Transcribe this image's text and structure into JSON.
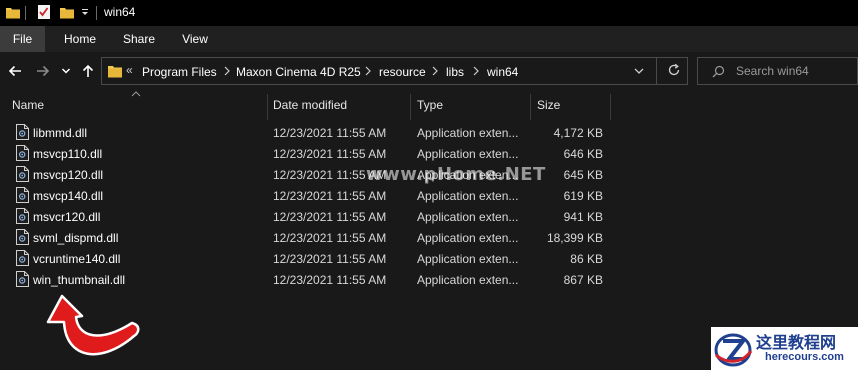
{
  "window": {
    "title": "win64"
  },
  "ribbon": {
    "tabs": [
      {
        "label": "File"
      },
      {
        "label": "Home"
      },
      {
        "label": "Share"
      },
      {
        "label": "View"
      }
    ]
  },
  "address": {
    "overflow_chevron": "«",
    "crumbs": [
      "Program Files",
      "Maxon Cinema 4D R25",
      "resource",
      "libs",
      "win64"
    ]
  },
  "search": {
    "placeholder": "Search win64"
  },
  "columns": {
    "name": "Name",
    "date": "Date modified",
    "type": "Type",
    "size": "Size"
  },
  "files": [
    {
      "name": "libmmd.dll",
      "date": "12/23/2021 11:55 AM",
      "type": "Application exten...",
      "size": "4,172 KB"
    },
    {
      "name": "msvcp110.dll",
      "date": "12/23/2021 11:55 AM",
      "type": "Application exten...",
      "size": "646 KB"
    },
    {
      "name": "msvcp120.dll",
      "date": "12/23/2021 11:55 AM",
      "type": "Application exten...",
      "size": "645 KB"
    },
    {
      "name": "msvcp140.dll",
      "date": "12/23/2021 11:55 AM",
      "type": "Application exten...",
      "size": "619 KB"
    },
    {
      "name": "msvcr120.dll",
      "date": "12/23/2021 11:55 AM",
      "type": "Application exten...",
      "size": "941 KB"
    },
    {
      "name": "svml_dispmd.dll",
      "date": "12/23/2021 11:55 AM",
      "type": "Application exten...",
      "size": "18,399 KB"
    },
    {
      "name": "vcruntime140.dll",
      "date": "12/23/2021 11:55 AM",
      "type": "Application exten...",
      "size": "86 KB"
    },
    {
      "name": "win_thumbnail.dll",
      "date": "12/23/2021 11:55 AM",
      "type": "Application exten...",
      "size": "867 KB"
    }
  ],
  "watermarks": {
    "center": "www.pHome.NET",
    "logo_cn": "这里教程网",
    "logo_en": "herecours.com"
  },
  "colors": {
    "background": "#191919",
    "titlebar": "#000000",
    "ribbon_bg": "#202020",
    "active_tab": "#3c3c3c",
    "folder": "#f3c951",
    "arrow": "#e01b1b",
    "logo_text": "#1f3f8f"
  },
  "icons": {
    "file_row": "dll-file-icon",
    "nav_back": "arrow-left-icon",
    "nav_forward": "arrow-right-icon",
    "nav_up": "arrow-up-icon",
    "refresh": "refresh-icon",
    "search": "search-icon"
  }
}
